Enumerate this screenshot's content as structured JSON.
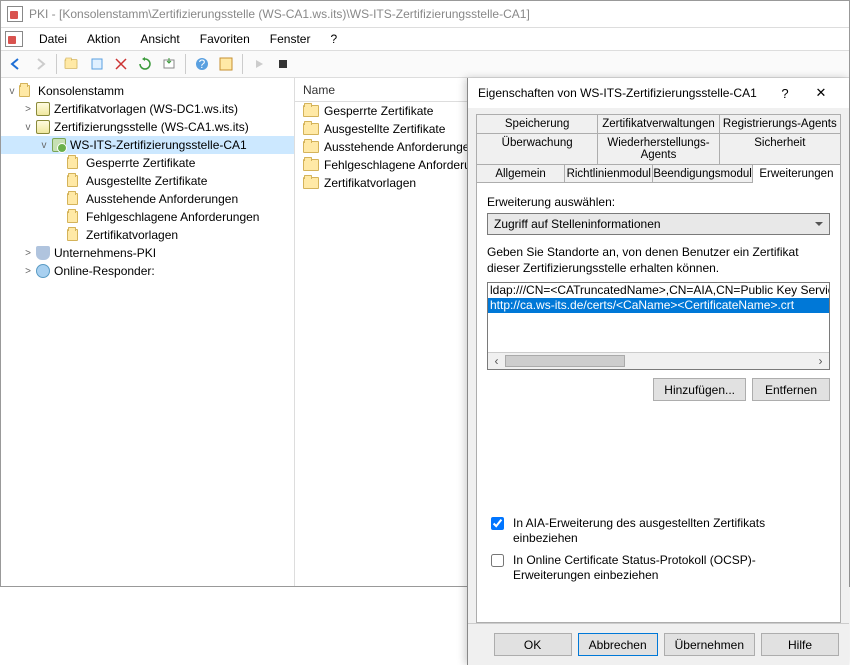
{
  "window": {
    "title": "PKI - [Konsolenstamm\\Zertifizierungsstelle (WS-CA1.ws.its)\\WS-ITS-Zertifizierungsstelle-CA1]"
  },
  "menu": {
    "items": [
      "Datei",
      "Aktion",
      "Ansicht",
      "Favoriten",
      "Fenster",
      "?"
    ]
  },
  "tree": {
    "root": "Konsolenstamm",
    "items": [
      {
        "label": "Zertifikatvorlagen (WS-DC1.ws.its)",
        "depth": 1,
        "exp": ">",
        "icon": "cert"
      },
      {
        "label": "Zertifizierungsstelle (WS-CA1.ws.its)",
        "depth": 1,
        "exp": "v",
        "icon": "cert"
      },
      {
        "label": "WS-ITS-Zertifizierungsstelle-CA1",
        "depth": 2,
        "exp": "v",
        "icon": "srv",
        "selected": true
      },
      {
        "label": "Gesperrte Zertifikate",
        "depth": 3,
        "exp": "",
        "icon": "folder"
      },
      {
        "label": "Ausgestellte Zertifikate",
        "depth": 3,
        "exp": "",
        "icon": "folder"
      },
      {
        "label": "Ausstehende Anforderungen",
        "depth": 3,
        "exp": "",
        "icon": "folder"
      },
      {
        "label": "Fehlgeschlagene Anforderungen",
        "depth": 3,
        "exp": "",
        "icon": "folder"
      },
      {
        "label": "Zertifikatvorlagen",
        "depth": 3,
        "exp": "",
        "icon": "folder"
      },
      {
        "label": "Unternehmens-PKI",
        "depth": 1,
        "exp": ">",
        "icon": "shield"
      },
      {
        "label": "Online-Responder:",
        "depth": 1,
        "exp": ">",
        "icon": "globe"
      }
    ]
  },
  "list": {
    "header": "Name",
    "rows": [
      "Gesperrte Zertifikate",
      "Ausgestellte Zertifikate",
      "Ausstehende Anforderungen",
      "Fehlgeschlagene Anforderungen",
      "Zertifikatvorlagen"
    ]
  },
  "dialog": {
    "title": "Eigenschaften von WS-ITS-Zertifizierungsstelle-CA1",
    "help": "?",
    "close": "✕",
    "tabs_row1": [
      "Speicherung",
      "Zertifikatverwaltungen",
      "Registrierungs-Agents"
    ],
    "tabs_row2": [
      "Überwachung",
      "Wiederherstellungs-Agents",
      "Sicherheit"
    ],
    "tabs_row3": [
      "Allgemein",
      "Richtlinienmodul",
      "Beendigungsmodul",
      "Erweiterungen"
    ],
    "active_tab": "Erweiterungen",
    "ext_label": "Erweiterung auswählen:",
    "ext_select": "Zugriff auf Stelleninformationen",
    "desc": "Geben Sie Standorte an, von denen Benutzer ein Zertifikat dieser Zertifizierungsstelle erhalten können.",
    "locations": [
      "ldap:///CN=<CATruncatedName>,CN=AIA,CN=Public Key Services,CN=S",
      "http://ca.ws-its.de/certs/<CaName><CertificateName>.crt"
    ],
    "selected_location_index": 1,
    "add": "Hinzufügen...",
    "remove": "Entfernen",
    "chk_aia": "In AIA-Erweiterung des ausgestellten Zertifikats einbeziehen",
    "chk_aia_checked": true,
    "chk_ocsp": "In Online Certificate Status-Protokoll (OCSP)-Erweiterungen einbeziehen",
    "chk_ocsp_checked": false,
    "buttons": {
      "ok": "OK",
      "cancel": "Abbrechen",
      "apply": "Übernehmen",
      "help": "Hilfe"
    }
  }
}
